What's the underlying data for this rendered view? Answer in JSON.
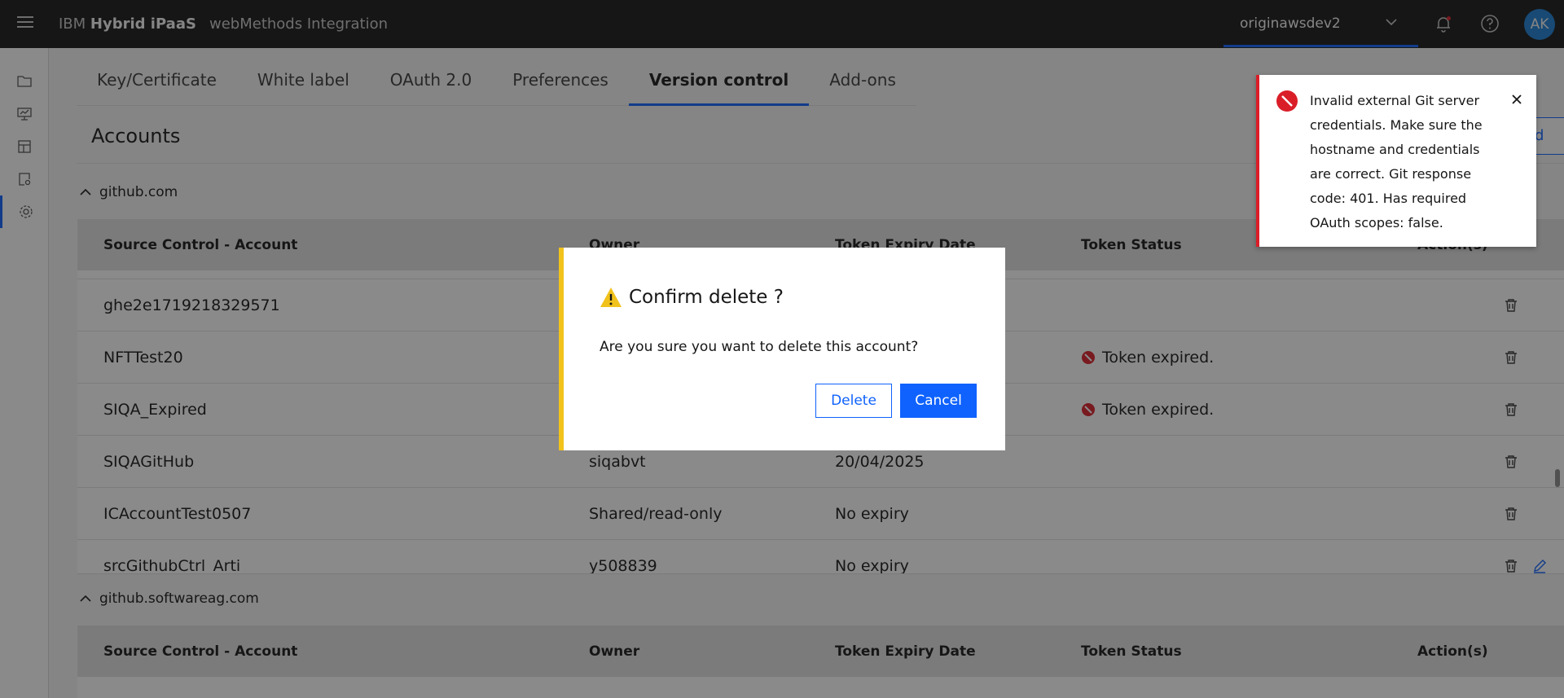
{
  "topbar": {
    "brand_prefix": "IBM",
    "brand_name": "Hybrid iPaaS",
    "product": "webMethods Integration",
    "tenant": "originawsdev2",
    "avatar": "AK",
    "icons": [
      "menu-icon",
      "chevron-down-icon",
      "notification-bell-icon",
      "help-icon"
    ]
  },
  "rail": {
    "items": [
      "folder-icon",
      "monitor-icon",
      "catalog-icon",
      "settings-search-icon",
      "gear-icon"
    ],
    "active": "gear-icon"
  },
  "tabs": [
    "Key/Certificate",
    "White label",
    "OAuth 2.0",
    "Preferences",
    "Version control",
    "Add-ons"
  ],
  "active_tab": "Version control",
  "page": {
    "title": "Accounts",
    "add_button": "ld"
  },
  "columns": [
    "Source Control - Account",
    "Owner",
    "Token Expiry Date",
    "Token Status",
    "Action(s)"
  ],
  "groups": [
    {
      "name": "github.com",
      "rows": [
        {
          "account": "ghe2e1719218329571",
          "owner": "",
          "expiry": "",
          "status": ""
        },
        {
          "account": "NFTTest20",
          "owner": "",
          "expiry": "",
          "status": "Token expired."
        },
        {
          "account": "SIQA_Expired",
          "owner": "",
          "expiry": "",
          "status": "Token expired."
        },
        {
          "account": "SIQAGitHub",
          "owner": "siqabvt",
          "expiry": "20/04/2025",
          "status": ""
        },
        {
          "account": "ICAccountTest0507",
          "owner": "Shared/read-only",
          "expiry": "No expiry",
          "status": ""
        },
        {
          "account": "srcGithubCtrl_Arti",
          "owner": "y508839",
          "expiry": "No expiry",
          "status": ""
        }
      ]
    },
    {
      "name": "github.softwareag.com",
      "rows": []
    }
  ],
  "modal": {
    "title": "Confirm delete ?",
    "body": "Are you sure you want to delete this account?",
    "delete_label": "Delete",
    "cancel_label": "Cancel"
  },
  "toast": {
    "message": "Invalid external Git server credentials. Make sure the hostname and credentials are correct. Git response code: 401. Has required OAuth scopes: false."
  },
  "colors": {
    "accent": "#0f62fe",
    "error": "#da1e28",
    "warning": "#f1c21b",
    "topbar": "#161616"
  }
}
